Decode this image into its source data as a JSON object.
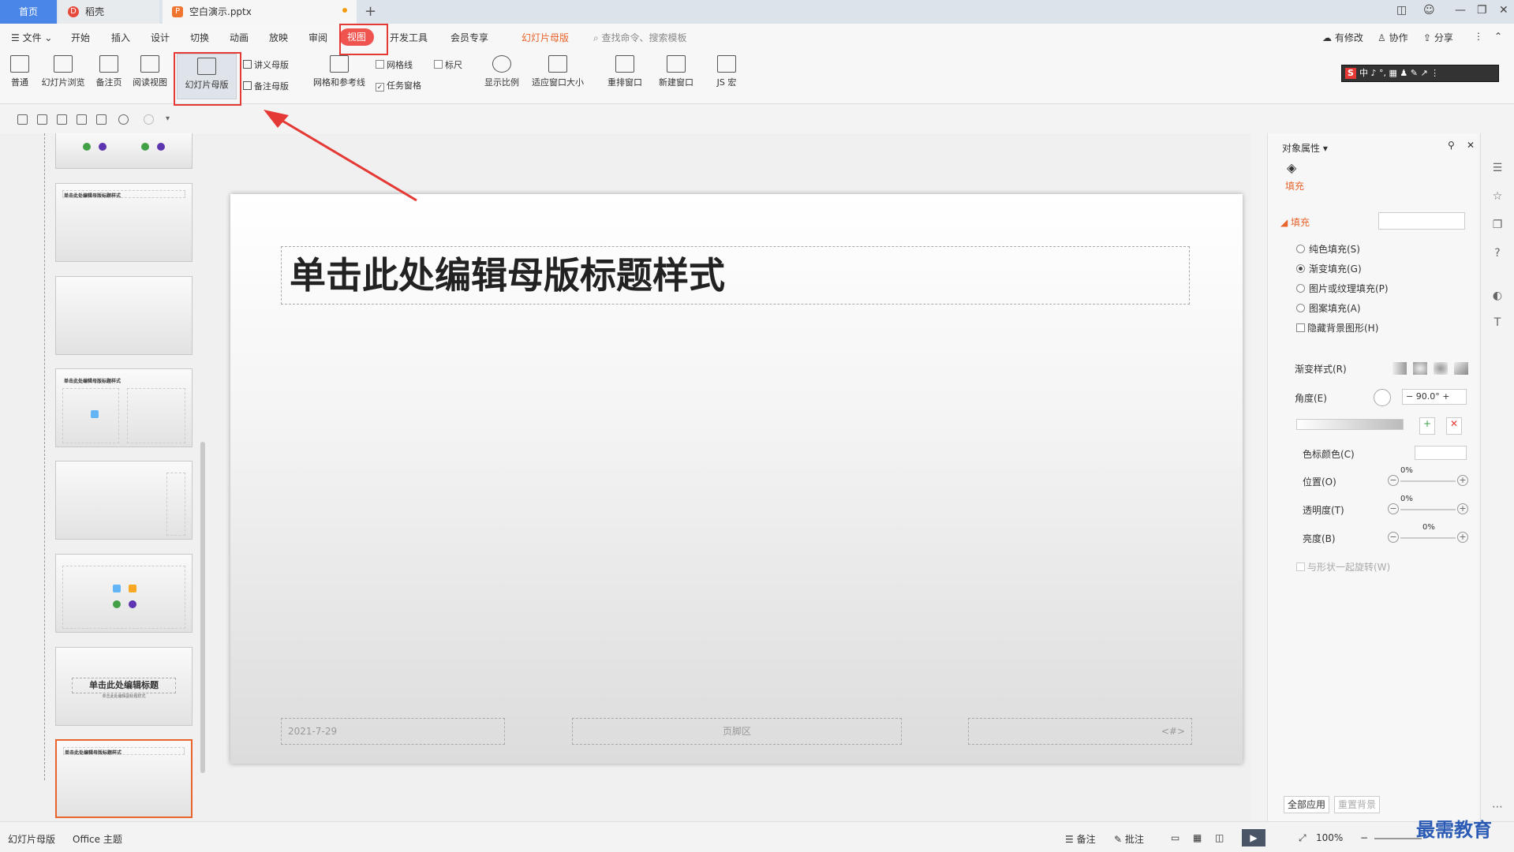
{
  "titlebar": {
    "home_tab": "首页",
    "tab1": "稻壳",
    "tab1_icon": "D",
    "tab2": "空白演示.pptx",
    "tab2_icon": "P",
    "new_tab": "+"
  },
  "menu": {
    "file": "文件",
    "items": [
      "开始",
      "插入",
      "设计",
      "切换",
      "动画",
      "放映",
      "审阅"
    ],
    "active": "视图",
    "dev": "开发工具",
    "member": "会员专享",
    "master": "幻灯片母版",
    "search": "查找命令、搜索模板",
    "modified": "有修改",
    "collab": "协作",
    "share": "分享"
  },
  "ribbon": {
    "normal": "普通",
    "slide_sorter": "幻灯片浏览",
    "notes_page": "备注页",
    "reading_view": "阅读视图",
    "slide_master": "幻灯片母版",
    "handout_master": "讲义母版",
    "notes_master": "备注母版",
    "grid_guides": "网格和参考线",
    "gridlines": "网格线",
    "ruler": "标尺",
    "task_pane": "任务窗格",
    "zoom": "显示比例",
    "fit_window": "适应窗口大小",
    "arrange": "重排窗口",
    "new_window": "新建窗口",
    "js_macro": "JS 宏"
  },
  "ime": "中 ♪ °, ▦ ♟ ✎ ↗ ⋮",
  "slide": {
    "title": "单击此处编辑母版标题样式",
    "date": "2021-7-29",
    "footer": "页脚区",
    "number": "<#>"
  },
  "thumbs": {
    "title_small": "单击此处编辑母版标题样式",
    "title_big": "单击此处编辑标题",
    "subtitle": "单击此处编辑副标题样式"
  },
  "panel": {
    "header": "对象属性",
    "tab_fill": "填充",
    "fill_section": "填充",
    "solid": "纯色填充(S)",
    "gradient": "渐变填充(G)",
    "picture": "图片或纹理填充(P)",
    "pattern": "图案填充(A)",
    "hide_bg": "隐藏背景图形(H)",
    "gradient_style": "渐变样式(R)",
    "angle": "角度(E)",
    "angle_value": "90.0°",
    "stop_color": "色标颜色(C)",
    "position": "位置(O)",
    "position_val": "0%",
    "transparency": "透明度(T)",
    "transparency_val": "0%",
    "brightness": "亮度(B)",
    "brightness_val": "0%",
    "rotate_with": "与形状一起旋转(W)",
    "apply_all": "全部应用",
    "reset_bg": "重置背景"
  },
  "status": {
    "mode": "幻灯片母版",
    "theme": "Office 主题",
    "notes": "备注",
    "comments": "批注",
    "zoom": "100%"
  },
  "watermark": "最需教育",
  "colors": {
    "accent_red": "#e53935",
    "accent_orange": "#e8642c",
    "tab_blue": "#4a86e8"
  }
}
